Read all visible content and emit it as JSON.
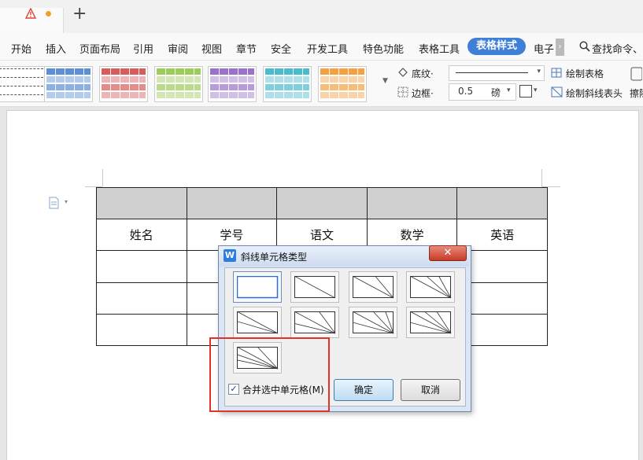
{
  "tabbar": {
    "new_tab": "+"
  },
  "menu": {
    "items": [
      "开始",
      "插入",
      "页面布局",
      "引用",
      "审阅",
      "视图",
      "章节",
      "安全",
      "开发工具",
      "特色功能",
      "表格工具"
    ],
    "active": "表格样式",
    "next": "电子",
    "more": "›",
    "search_placeholder": "查找命令、"
  },
  "ribbon": {
    "shading": "底纹·",
    "border": "边框·",
    "draw_table": "绘制表格",
    "draw_diagonal_header": "绘制斜线表头",
    "eraser": "擦除",
    "line_weight_value": "0.5",
    "line_weight_unit": "磅",
    "style_colors": [
      "#ffffff",
      "#5b8fd6",
      "#d95c5c",
      "#9ccc5a",
      "#9b72c9",
      "#4bbccf",
      "#f3a142"
    ]
  },
  "table": {
    "headers": [
      "姓名",
      "学号",
      "语文",
      "数学",
      "英语"
    ],
    "rows": 3
  },
  "dialog": {
    "title": "斜线单元格类型",
    "close": "✕",
    "merge_checked": true,
    "checkmark": "✓",
    "merge_label": "合并选中单元格(M)",
    "ok": "确定",
    "cancel": "取消"
  }
}
